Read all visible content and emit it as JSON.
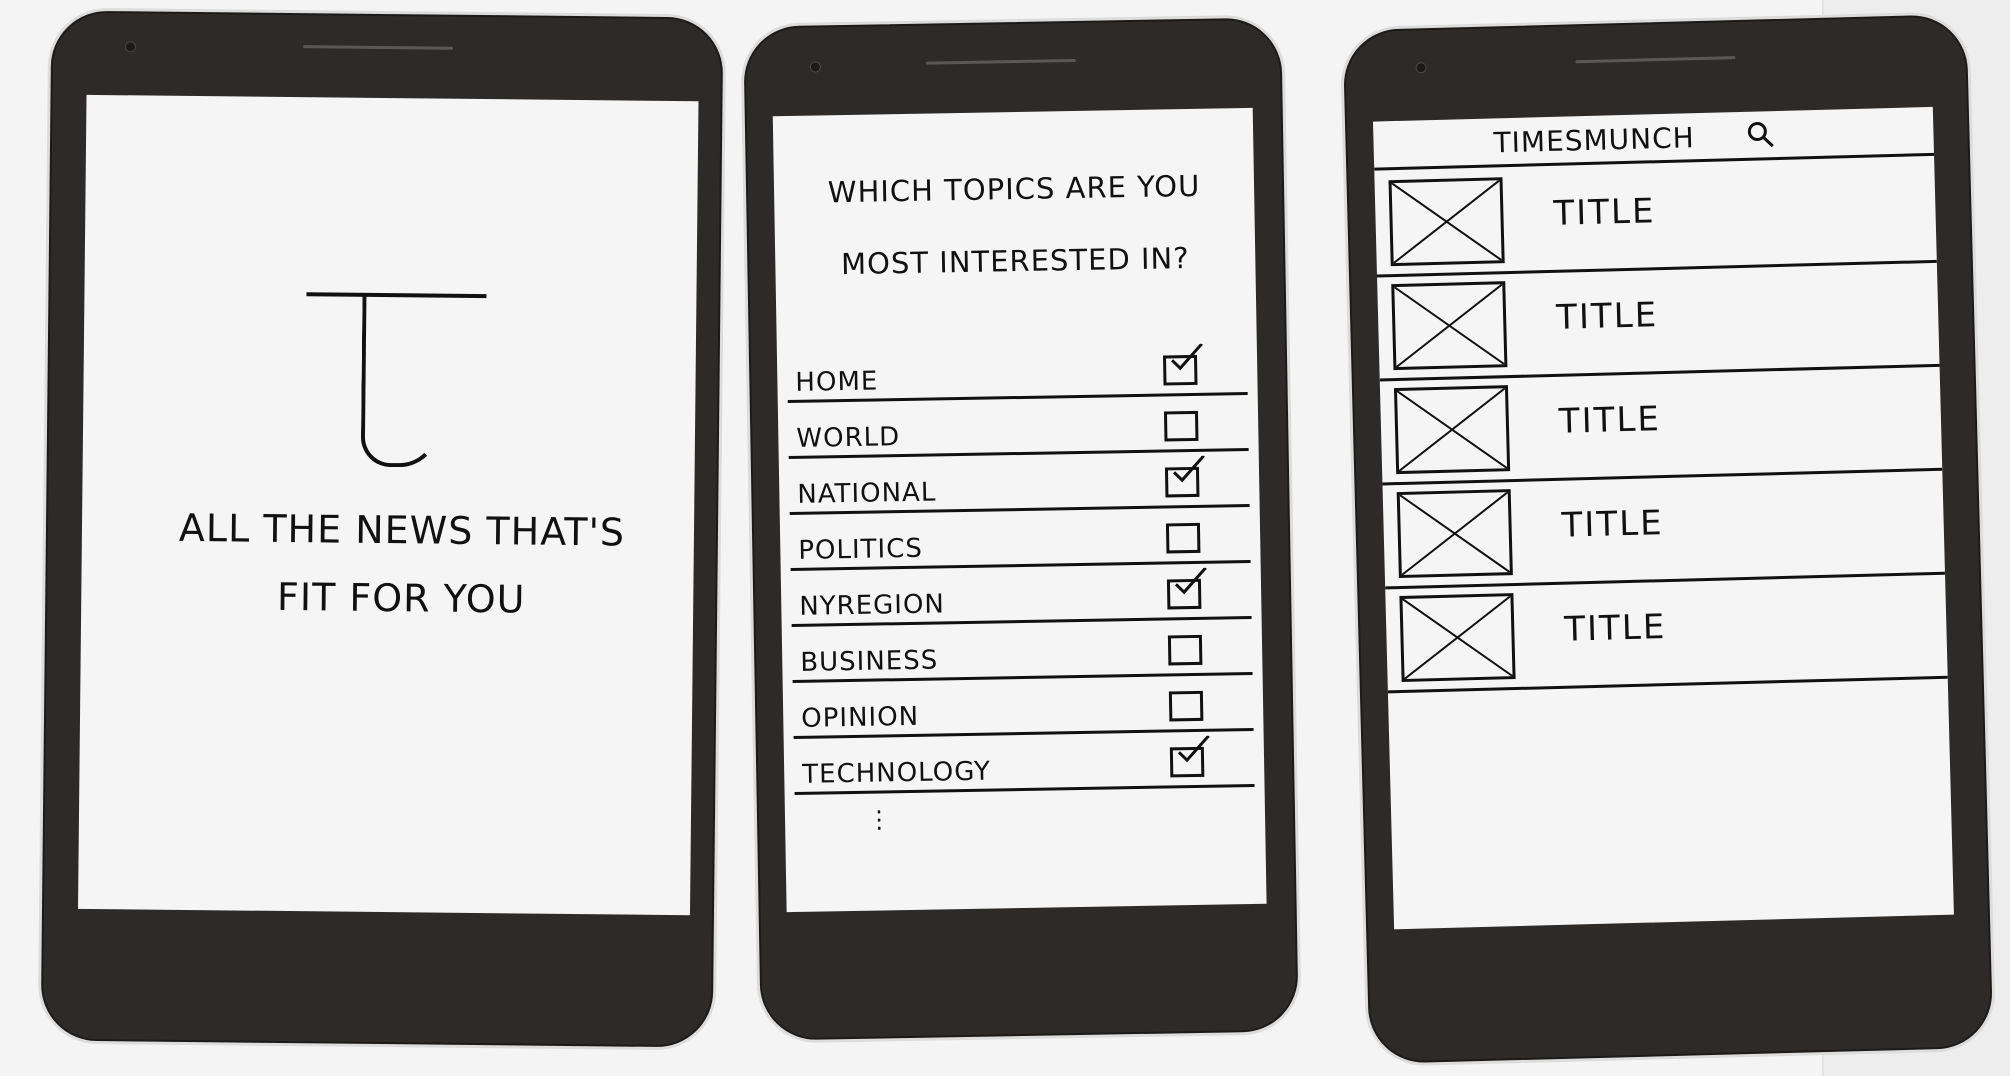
{
  "splash": {
    "logo_letter": "T",
    "tagline_line1": "All The News That's",
    "tagline_line2": "Fit For You"
  },
  "topics_screen": {
    "question_line1": "Which Topics Are You",
    "question_line2": "Most Interested In?",
    "topics": [
      {
        "label": "Home",
        "checked": true
      },
      {
        "label": "World",
        "checked": false
      },
      {
        "label": "National",
        "checked": true
      },
      {
        "label": "Politics",
        "checked": false
      },
      {
        "label": "NYRegion",
        "checked": true
      },
      {
        "label": "Business",
        "checked": false
      },
      {
        "label": "Opinion",
        "checked": false
      },
      {
        "label": "Technology",
        "checked": true
      }
    ],
    "more_indicator": "⋮"
  },
  "feed_screen": {
    "app_title": "TimesMunch",
    "search_icon": "search-icon",
    "articles": [
      {
        "title": "Title"
      },
      {
        "title": "Title"
      },
      {
        "title": "Title"
      },
      {
        "title": "Title"
      },
      {
        "title": "Title"
      }
    ]
  }
}
